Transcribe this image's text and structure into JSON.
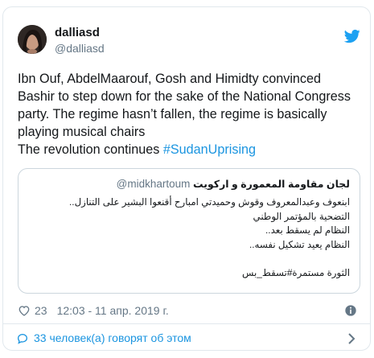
{
  "tweet": {
    "author_name": "dalliasd",
    "author_handle": "@dalliasd",
    "text_lines": [
      "Ibn Ouf, AbdelMaarouf, Gosh and Himidty convinced",
      "Bashir to step down for the sake of the National Congress",
      "party. The regime hasn’t fallen, the regime is basically",
      "playing musical chairs"
    ],
    "last_line_prefix": "The revolution continues ",
    "hashtag": "#SudanUprising"
  },
  "quoted_tweet": {
    "author_name": "لجان مقاومة المعمورة و اركويت",
    "author_handle": "@midkhartoum",
    "lines": [
      "ابنعوف وعبدالمعروف وقوش وحميدتي امبارح أقنعوا البشير على التنازل..",
      "التضحية بالمؤتمر الوطني",
      "النظام لم يسقط بعد..",
      "النظام يعيد تشكيل نفسه..",
      "",
      "الثورة مستمرة#تسقط_بس"
    ]
  },
  "meta": {
    "likes": "23",
    "timestamp": "12:03 - 11 апр. 2019 г."
  },
  "footer": {
    "replies_text": "33 человек(а) говорят об этом"
  },
  "icons": {
    "heart": "heart-icon",
    "info": "info-icon",
    "reply": "reply-icon",
    "twitter": "twitter-bird-icon",
    "chevron": "chevron-right-icon"
  },
  "colors": {
    "link": "#1b95e0",
    "secondary_text": "#657786",
    "twitter_blue": "#1da1f2",
    "border": "#e1e8ed"
  }
}
